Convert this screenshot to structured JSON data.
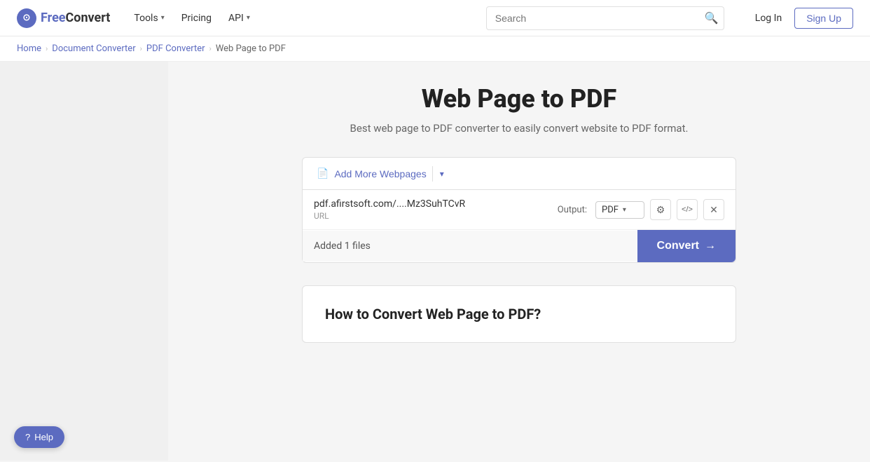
{
  "navbar": {
    "logo_icon": "⊙",
    "logo_free": "Free",
    "logo_convert": "Convert",
    "tools_label": "Tools",
    "pricing_label": "Pricing",
    "api_label": "API",
    "search_placeholder": "Search",
    "login_label": "Log In",
    "signup_label": "Sign Up"
  },
  "breadcrumb": {
    "home": "Home",
    "document_converter": "Document Converter",
    "pdf_converter": "PDF Converter",
    "current": "Web Page to PDF"
  },
  "hero": {
    "title": "Web Page to PDF",
    "subtitle": "Best web page to PDF converter to easily convert website to PDF format."
  },
  "converter": {
    "add_webpages_label": "Add More Webpages",
    "file_url": "pdf.afirstsoft.com/....Mz3SuhTCvR",
    "file_type_label": "URL",
    "output_label": "Output:",
    "output_format": "PDF",
    "files_count": "Added 1 files",
    "convert_label": "Convert"
  },
  "how_to": {
    "title": "How to Convert Web Page to PDF?"
  },
  "help": {
    "label": "Help"
  },
  "icons": {
    "search": "🔍",
    "chevron_down": "▾",
    "chevron_right": "›",
    "file_doc": "📄",
    "settings": "⚙",
    "code": "</>",
    "close": "✕",
    "arrow_right": "→",
    "question": "?"
  }
}
